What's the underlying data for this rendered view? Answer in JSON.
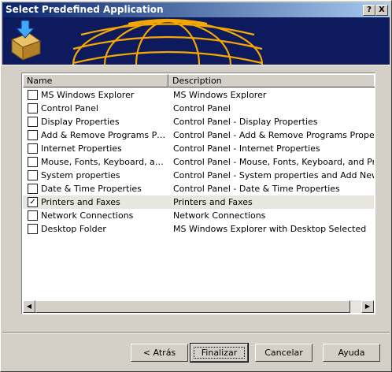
{
  "window": {
    "title": "Select Predefined Application",
    "help_glyph": "?",
    "close_glyph": "X"
  },
  "list": {
    "columns": [
      "Name",
      "Description"
    ],
    "rows": [
      {
        "name": "MS Windows Explorer",
        "desc": "MS Windows Explorer",
        "checked": false
      },
      {
        "name": "Control Panel",
        "desc": "Control Panel",
        "checked": false
      },
      {
        "name": "Display Properties",
        "desc": "Control Panel - Display Properties",
        "checked": false
      },
      {
        "name": "Add & Remove Programs Prop...",
        "desc": "Control Panel - Add & Remove Programs Properties",
        "checked": false
      },
      {
        "name": "Internet Properties",
        "desc": "Control Panel - Internet Properties",
        "checked": false
      },
      {
        "name": "Mouse, Fonts, Keyboard, and ...",
        "desc": "Control Panel - Mouse, Fonts, Keyboard, and Printers",
        "checked": false
      },
      {
        "name": "System properties",
        "desc": "Control Panel - System properties and Add New Hard",
        "checked": false
      },
      {
        "name": "Date & Time Properties",
        "desc": "Control Panel - Date & Time Properties",
        "checked": false
      },
      {
        "name": "Printers and Faxes",
        "desc": "Printers and Faxes",
        "checked": true,
        "selected": true
      },
      {
        "name": "Network Connections",
        "desc": "Network Connections",
        "checked": false
      },
      {
        "name": "Desktop Folder",
        "desc": "MS Windows Explorer with Desktop Selected",
        "checked": false
      }
    ],
    "scroll_left_glyph": "◀",
    "scroll_right_glyph": "▶",
    "check_glyph": "✓"
  },
  "buttons": {
    "back": "< Atrás",
    "finish": "Finalizar",
    "cancel": "Cancelar",
    "help": "Ayuda"
  },
  "colors": {
    "title_start": "#0a246a",
    "title_end": "#a6caf0",
    "banner_bg": "#0e1a5e",
    "globe": "#f5a800"
  }
}
